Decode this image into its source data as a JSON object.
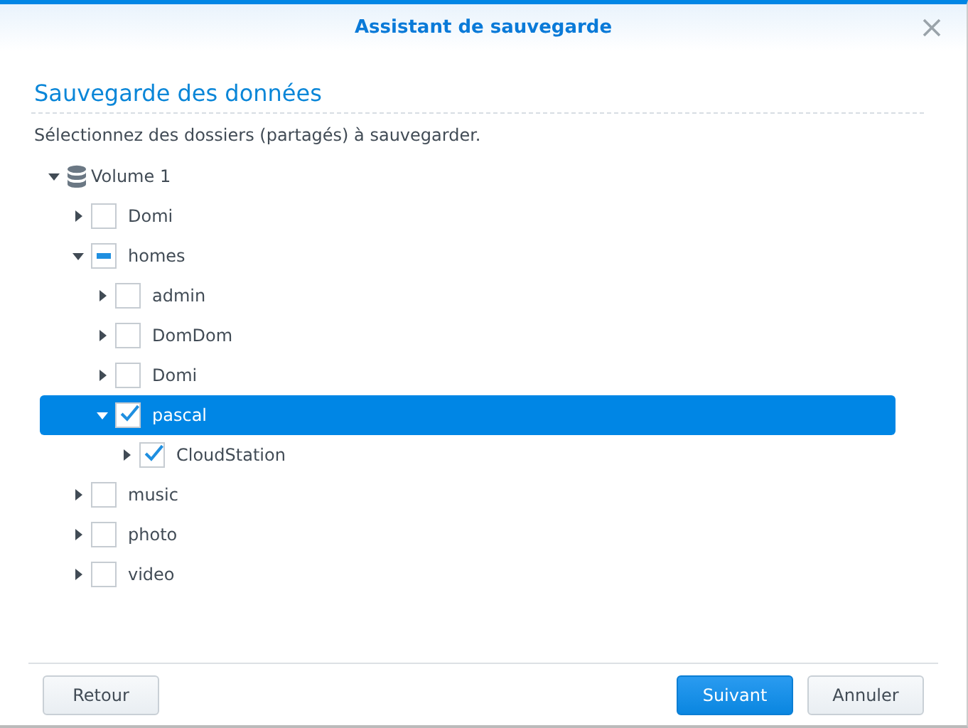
{
  "window": {
    "title": "Assistant de sauvegarde"
  },
  "heading": "Sauvegarde des données",
  "description": "Sélectionnez des dossiers (partagés) à sauvegarder.",
  "tree": [
    {
      "kind": "volume",
      "label": "Volume 1",
      "expanded": true,
      "selected": false,
      "children": [
        {
          "kind": "folder",
          "label": "Domi",
          "expanded": false,
          "selected": false,
          "checked": false,
          "partial": false
        },
        {
          "kind": "folder",
          "label": "homes",
          "expanded": true,
          "selected": false,
          "checked": false,
          "partial": true,
          "children": [
            {
              "kind": "folder",
              "label": "admin",
              "expanded": false,
              "selected": false,
              "checked": false,
              "partial": false
            },
            {
              "kind": "folder",
              "label": "DomDom",
              "expanded": false,
              "selected": false,
              "checked": false,
              "partial": false
            },
            {
              "kind": "folder",
              "label": "Domi",
              "expanded": false,
              "selected": false,
              "checked": false,
              "partial": false
            },
            {
              "kind": "folder",
              "label": "pascal",
              "expanded": true,
              "selected": true,
              "checked": true,
              "partial": false,
              "children": [
                {
                  "kind": "folder",
                  "label": "CloudStation",
                  "expanded": false,
                  "selected": false,
                  "checked": true,
                  "partial": false
                }
              ]
            }
          ]
        },
        {
          "kind": "folder",
          "label": "music",
          "expanded": false,
          "selected": false,
          "checked": false,
          "partial": false
        },
        {
          "kind": "folder",
          "label": "photo",
          "expanded": false,
          "selected": false,
          "checked": false,
          "partial": false
        },
        {
          "kind": "folder",
          "label": "video",
          "expanded": false,
          "selected": false,
          "checked": false,
          "partial": false
        }
      ]
    }
  ],
  "buttons": [
    {
      "label": "Retour",
      "kind": "secondary"
    },
    {
      "label": "Suivant",
      "kind": "primary"
    },
    {
      "label": "Annuler",
      "kind": "secondary"
    }
  ]
}
